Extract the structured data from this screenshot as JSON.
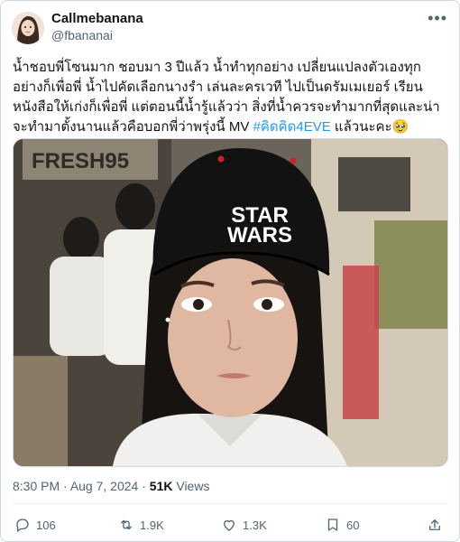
{
  "user": {
    "display_name": "Callmebanana",
    "handle": "@fbananai"
  },
  "tweet": {
    "text_main": "น้ำชอบพี่โซนมาก ชอบมา 3 ปีแล้ว น้ำทำทุกอย่าง เปลี่ยนแปลงตัวเองทุกอย่างก็เพื่อพี่ น้ำไปคัดเลือกนางรำ เล่นละครเวที ไปเป็นดรัมเมเยอร์ เรียนหนังสือให้เก่งก็เพื่อพี่ แต่ตอนนี้น้ำรู้แล้วว่า สิ่งที่น้ำควรจะทำมากที่สุดและน่าจะทำมาตั้งนานแล้วคือบอกพี่ว่าพรุ่งนี้ MV ",
    "hashtag": "#คิดคิด4EVE",
    "text_tail": " แล้วนะคะ",
    "emoji": "🥹"
  },
  "media": {
    "sign_text": "FRESH95",
    "cap_text_line1": "STAR",
    "cap_text_line2": "WARS"
  },
  "meta": {
    "time": "8:30 PM",
    "date": "Aug 7, 2024",
    "views_count": "51K",
    "views_label": "Views"
  },
  "actions": {
    "replies": "106",
    "reposts": "1.9K",
    "likes": "1.3K",
    "bookmarks": "60"
  }
}
